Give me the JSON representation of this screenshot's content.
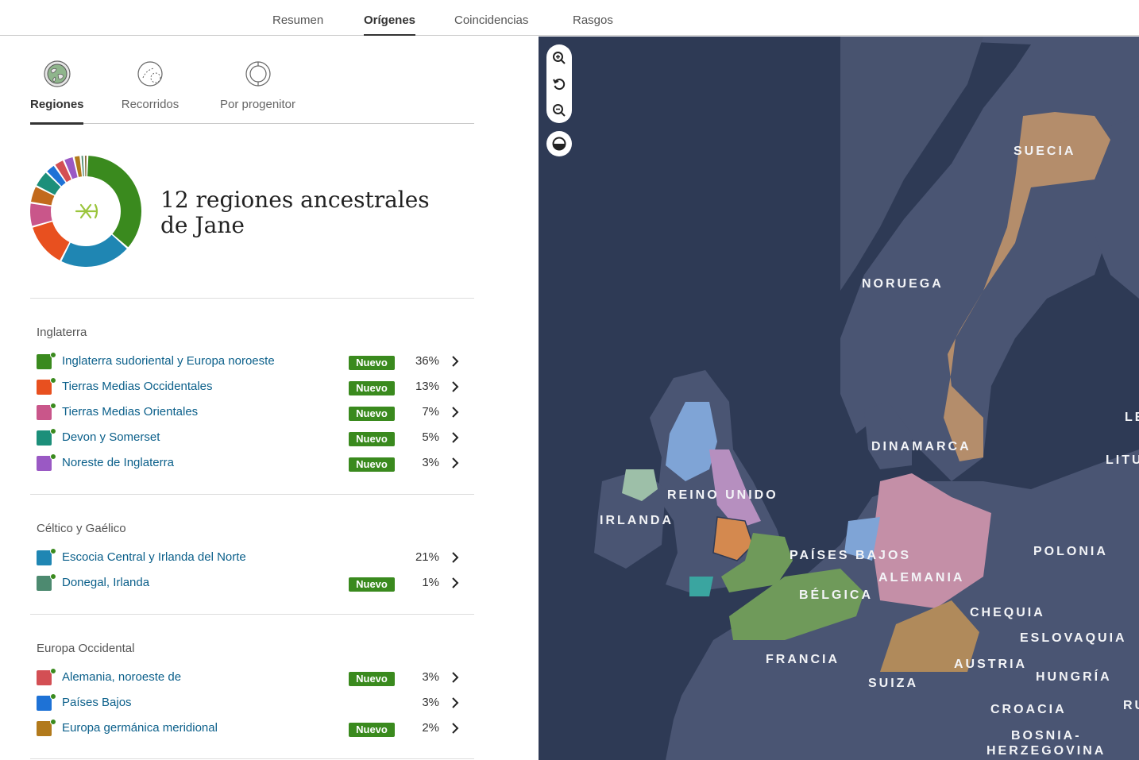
{
  "nav": {
    "tabs": [
      "Resumen",
      "Orígenes",
      "Coincidencias",
      "Rasgos"
    ],
    "active": "Orígenes"
  },
  "subtabs": [
    {
      "label": "Regiones",
      "icon": "globe-icon",
      "active": true
    },
    {
      "label": "Recorridos",
      "icon": "journeys-icon",
      "active": false
    },
    {
      "label": "Por progenitor",
      "icon": "parents-icon",
      "active": false
    }
  ],
  "summary": {
    "headline": "12 regiones ancestrales de Jane",
    "donut_center_icon": "ancestry-leaf-icon",
    "donut_segments": [
      {
        "value": 36,
        "color": "#3a8a1e"
      },
      {
        "value": 21,
        "color": "#1f86b3"
      },
      {
        "value": 13,
        "color": "#e8501f"
      },
      {
        "value": 7,
        "color": "#c9568a"
      },
      {
        "value": 5,
        "color": "#c26a1c"
      },
      {
        "value": 5,
        "color": "#1c8f7a"
      },
      {
        "value": 3,
        "color": "#1e72d6"
      },
      {
        "value": 3,
        "color": "#d34f54"
      },
      {
        "value": 3,
        "color": "#9a59c4"
      },
      {
        "value": 2,
        "color": "#b27a1c"
      },
      {
        "value": 1,
        "color": "#4d8a70"
      },
      {
        "value": 1,
        "color": "#8a6d3b"
      }
    ]
  },
  "groups": [
    {
      "title": "Inglaterra",
      "items": [
        {
          "name": "Inglaterra sudoriental y Europa noroeste",
          "badge": "Nuevo",
          "pct": "36%",
          "color": "#3a8a1e"
        },
        {
          "name": "Tierras Medias Occidentales",
          "badge": "Nuevo",
          "pct": "13%",
          "color": "#e8501f"
        },
        {
          "name": "Tierras Medias Orientales",
          "badge": "Nuevo",
          "pct": "7%",
          "color": "#c9568a"
        },
        {
          "name": "Devon y Somerset",
          "badge": "Nuevo",
          "pct": "5%",
          "color": "#1c8f7a"
        },
        {
          "name": "Noreste de Inglaterra",
          "badge": "Nuevo",
          "pct": "3%",
          "color": "#9a59c4"
        }
      ]
    },
    {
      "title": "Céltico y Gaélico",
      "items": [
        {
          "name": "Escocia Central y Irlanda del Norte",
          "badge": "",
          "pct": "21%",
          "color": "#1f86b3"
        },
        {
          "name": "Donegal, Irlanda",
          "badge": "Nuevo",
          "pct": "1%",
          "color": "#4d8a70"
        }
      ]
    },
    {
      "title": "Europa Occidental",
      "items": [
        {
          "name": "Alemania, noroeste de",
          "badge": "Nuevo",
          "pct": "3%",
          "color": "#d34f54"
        },
        {
          "name": "Países Bajos",
          "badge": "",
          "pct": "3%",
          "color": "#1e72d6"
        },
        {
          "name": "Europa germánica meridional",
          "badge": "Nuevo",
          "pct": "2%",
          "color": "#b27a1c"
        }
      ]
    }
  ],
  "map": {
    "labels": {
      "suecia": "SUECIA",
      "noruega": "NORUEGA",
      "dinamarca": "DINAMARCA",
      "reino_unido": "REINO UNIDO",
      "irlanda": "IRLANDA",
      "paises_bajos": "PAÍSES BAJOS",
      "alemania": "ALEMANIA",
      "polonia": "POLONIA",
      "belgica": "BÉLGICA",
      "chequia": "CHEQUIA",
      "eslovaquia": "ESLOVAQUIA",
      "francia": "FRANCIA",
      "austria": "AUSTRIA",
      "suiza": "SUIZA",
      "hungria": "HUNGRÍA",
      "croacia": "CROACIA",
      "bosnia": "BOSNIA-",
      "herzegovina": "HERZEGOVINA",
      "le": "LE",
      "litu": "LITU",
      "ru": "RU"
    },
    "controls": [
      "zoom-in-icon",
      "reset-icon",
      "zoom-out-icon",
      "layer-toggle-icon"
    ]
  }
}
